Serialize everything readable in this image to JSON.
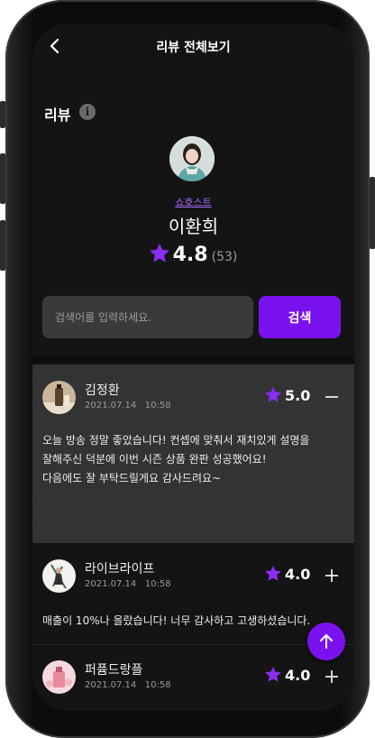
{
  "header": {
    "title": "리뷰 전체보기",
    "back_icon": "chevron-left-icon"
  },
  "section": {
    "title": "리뷰",
    "info_icon_glyph": "i"
  },
  "host": {
    "role": "쇼호스트",
    "name": "이환희",
    "rating": "4.8",
    "count": "(53)"
  },
  "search": {
    "placeholder": "검색어를 입력하세요.",
    "button_label": "검색"
  },
  "reviews": [
    {
      "name": "김정환",
      "date": "2021.07.14   10:58",
      "score": "5.0",
      "expanded": true,
      "toggle_icon": "minus-icon",
      "body": "오늘 방송 정말 좋았습니다! 컨셉에 맞춰서 재치있게 설명을\n잘해주신 덕분에 이번 시즌 상품 완판 성공했어요!\n다음에도 잘 부탁드릴게요 감사드려요~"
    },
    {
      "name": "라이브라이프",
      "date": "2021.07.14   10:58",
      "score": "4.0",
      "expanded": false,
      "toggle_icon": "plus-icon",
      "body": "매출이 10%나 올랐습니다! 너무 감사하고 고생하셨습니다."
    },
    {
      "name": "퍼퓸드랑플",
      "date": "2021.07.14   10:58",
      "score": "4.0",
      "expanded": false,
      "toggle_icon": "plus-icon",
      "body": ""
    }
  ],
  "fab": {
    "icon": "arrow-up-icon"
  },
  "colors": {
    "accent": "#7a12f0",
    "star": "#8a2cf2",
    "role_link": "#a86cff",
    "background": "#141414",
    "expanded_card": "#333333"
  }
}
